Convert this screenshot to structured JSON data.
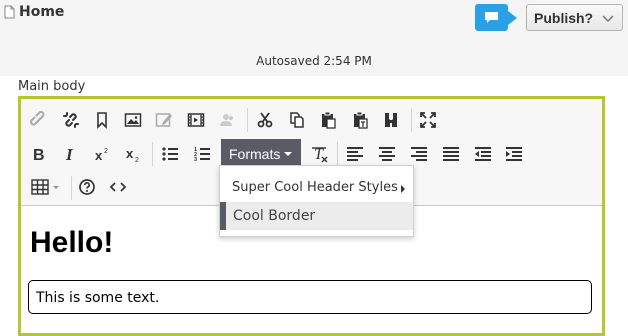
{
  "header": {
    "page_title": "Home",
    "publish_label": "Publish?",
    "autosaved": "Autosaved 2:54 PM"
  },
  "field": {
    "label": "Main body"
  },
  "toolbar": {
    "formats_label": "Formats",
    "row1": [
      "link-icon",
      "unlink-icon",
      "bookmark-icon",
      "image-icon",
      "edit-image-icon",
      "media-icon",
      "user-icon",
      "cut-icon",
      "copy-icon",
      "paste-icon",
      "paste-text-icon",
      "find-icon",
      "fullscreen-icon"
    ],
    "row2": [
      "bold-icon",
      "italic-icon",
      "superscript-icon",
      "subscript-icon",
      "bullet-list-icon",
      "numbered-list-icon",
      "clear-formatting-icon",
      "align-left-icon",
      "align-center-icon",
      "align-right-icon",
      "justify-icon",
      "outdent-icon",
      "indent-icon"
    ],
    "row3": [
      "table-icon",
      "help-icon",
      "code-icon"
    ]
  },
  "formats_menu": {
    "items": [
      {
        "label": "Super Cool Header Styles",
        "has_submenu": true
      },
      {
        "label": "Cool Border",
        "selected": true
      }
    ]
  },
  "content": {
    "heading": "Hello!",
    "bordered_text": "This is some text."
  },
  "colors": {
    "accent": "#b6c72b",
    "chat": "#2aa1e6",
    "formats_button": "#595c65"
  }
}
